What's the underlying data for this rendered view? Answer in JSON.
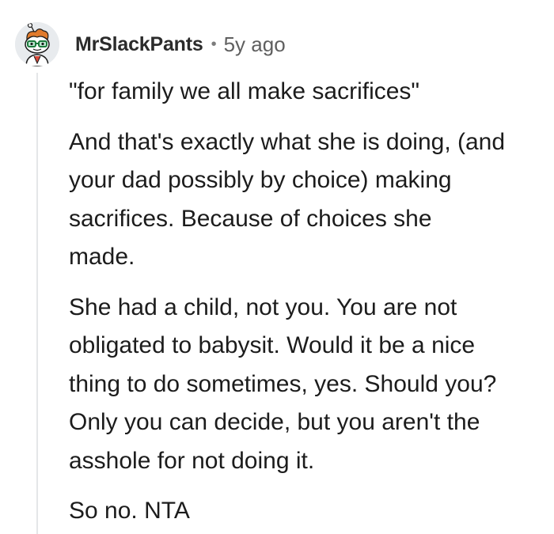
{
  "comment": {
    "author": "MrSlackPants",
    "separator": "•",
    "age": "5y ago",
    "avatar_icon": "snoo-nerd-avatar-icon",
    "paragraphs": [
      [
        "\"for family we all make sacrifices\""
      ],
      [
        "And that's exactly what she is doing, (and",
        "your dad possibly by choice) making",
        "sacrifices. Because of choices she",
        "made."
      ],
      [
        "She had a child, not you. You are not",
        "obligated to babysit. Would it be a nice",
        "thing to do sometimes, yes. Should you?",
        "Only you can decide, but you aren't the",
        "asshole for not doing it."
      ],
      [
        "So no. NTA"
      ]
    ]
  },
  "colors": {
    "text": "#1c1c1c",
    "meta": "#5f5f5f",
    "thread_line": "#e4e6e8"
  }
}
